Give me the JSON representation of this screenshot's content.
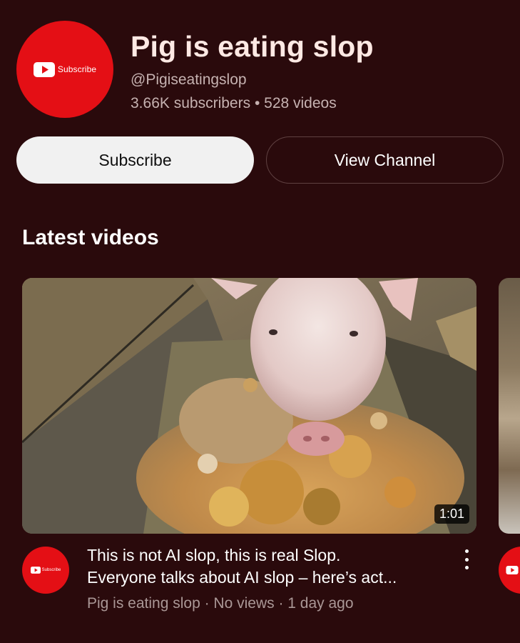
{
  "channel": {
    "title": "Pig is eating slop",
    "handle": "@Pigiseatingslop",
    "subscribers": "3.66K subscribers",
    "separator": "•",
    "videos": "528 videos",
    "avatar_text": "Subscribe",
    "avatar_icon": "youtube-play-icon",
    "brand_color": "#e40f15"
  },
  "actions": {
    "subscribe_label": "Subscribe",
    "view_channel_label": "View Channel"
  },
  "section": {
    "title": "Latest videos"
  },
  "videos": [
    {
      "duration": "1:01",
      "title_line1": "This is not AI slop, this is real Slop.",
      "title_line2": "Everyone talks about AI slop – here’s act...",
      "meta": "Pig is eating slop · No views · 1 day ago",
      "avatar_text": "Subscribe"
    }
  ],
  "colors": {
    "background": "#2a0a0c",
    "subscribe_button": "#f1f1f1",
    "secondary_text": "#c6b2b1"
  }
}
